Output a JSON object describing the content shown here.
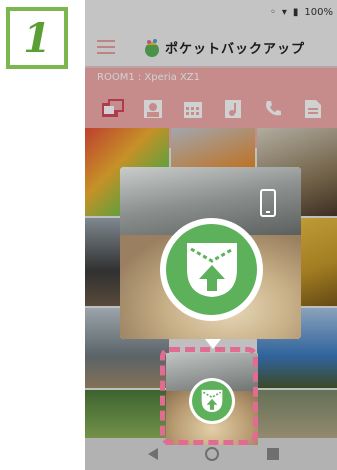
{
  "step": {
    "number": "1"
  },
  "status_bar": {
    "battery_text": "100%"
  },
  "app": {
    "title": "ポケットバックアップ",
    "room_label": "ROOM1 : Xperia XZ1"
  },
  "tabs": [
    {
      "icon": "photo-video-icon"
    },
    {
      "icon": "contact-icon"
    },
    {
      "icon": "calendar-icon"
    },
    {
      "icon": "music-icon"
    },
    {
      "icon": "phone-icon"
    },
    {
      "icon": "document-icon"
    }
  ],
  "colors": {
    "accent_green": "#5cb15a",
    "step_green": "#7ab84f",
    "pink_bar": "#f2aaaa",
    "highlight_pink": "#e26b92"
  }
}
